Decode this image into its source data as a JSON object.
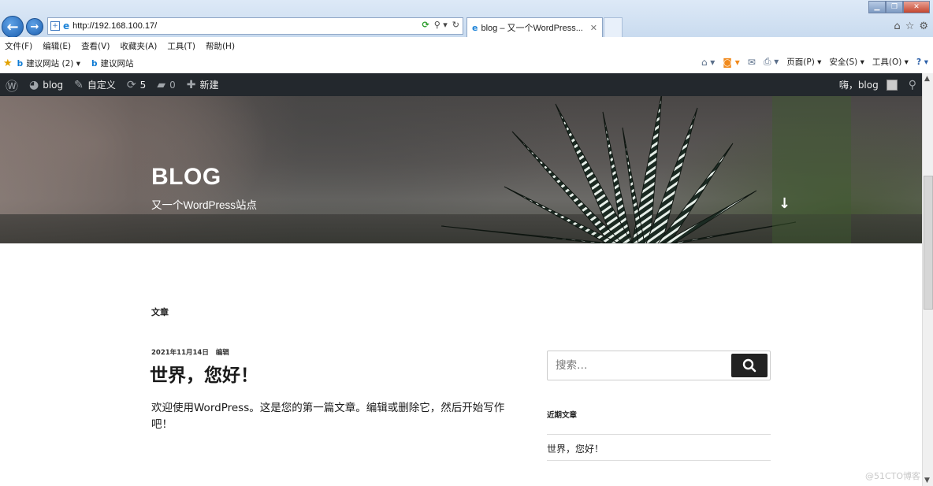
{
  "browser": {
    "url": "http://192.168.100.17/",
    "tab_title": "blog – 又一个WordPress...",
    "menu": [
      "文件(F)",
      "编辑(E)",
      "查看(V)",
      "收藏夹(A)",
      "工具(T)",
      "帮助(H)"
    ],
    "favorites": [
      {
        "label": "建议网站 (2) ▾"
      },
      {
        "label": "建议网站"
      }
    ],
    "commands": {
      "page": "页面(P) ▾",
      "safety": "安全(S) ▾",
      "tools": "工具(O) ▾"
    }
  },
  "admin_bar": {
    "site_name": "blog",
    "customize": "自定义",
    "updates_count": "5",
    "comments_count": "0",
    "new_label": "新建",
    "greeting": "嗨，blog"
  },
  "header": {
    "site_title": "BLOG",
    "site_description": "又一个WordPress站点"
  },
  "content": {
    "section_title": "文章",
    "post": {
      "date": "2021年11月14日",
      "edit": "编辑",
      "title": "世界，您好！",
      "excerpt": "欢迎使用WordPress。这是您的第一篇文章。编辑或删除它，然后开始写作吧！"
    }
  },
  "sidebar": {
    "search_placeholder": "搜索…",
    "recent_title": "近期文章",
    "recent_posts": [
      {
        "title": "世界，您好！"
      }
    ]
  },
  "watermark": "@51CTO博客"
}
